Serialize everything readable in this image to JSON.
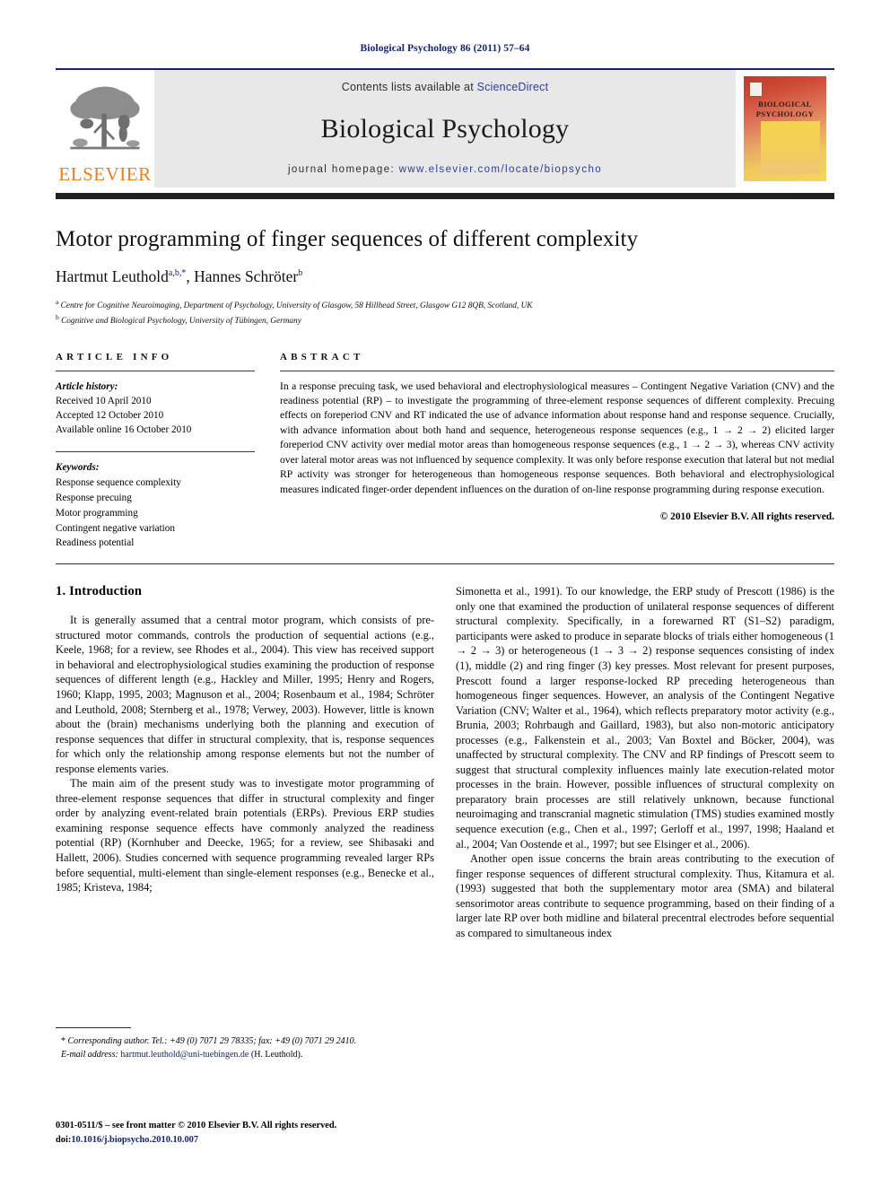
{
  "running_head": "Biological Psychology 86 (2011) 57–64",
  "masthead": {
    "contents_prefix": "Contents lists available at ",
    "sciencedirect": "ScienceDirect",
    "journal_title": "Biological Psychology",
    "homepage_prefix": "journal homepage: ",
    "homepage_url": "www.elsevier.com/locate/biopsycho",
    "publisher_logo_text": "ELSEVIER",
    "cover_title": "BIOLOGICAL PSYCHOLOGY",
    "accent_blue": "#2b3f97",
    "accent_orange": "#ef7d1a",
    "rule_dark": "#231f20"
  },
  "article": {
    "title": "Motor programming of finger sequences of different complexity",
    "authors_html": "Hartmut Leuthold<sup>a,b,*</sup>, Hannes Schröter<sup>b</sup>",
    "affiliation_a": "Centre for Cognitive Neuroimaging, Department of Psychology, University of Glasgow, 58 Hillhead Street, Glasgow G12 8QB, Scotland, UK",
    "affiliation_b": "Cognitive and Biological Psychology, University of Tübingen, Germany"
  },
  "article_info": {
    "heading": "ARTICLE INFO",
    "history_label": "Article history:",
    "received": "Received 10 April 2010",
    "accepted": "Accepted 12 October 2010",
    "available": "Available online 16 October 2010",
    "keywords_label": "Keywords:",
    "keywords": [
      "Response sequence complexity",
      "Response precuing",
      "Motor programming",
      "Contingent negative variation",
      "Readiness potential"
    ]
  },
  "abstract": {
    "heading": "ABSTRACT",
    "text": "In a response precuing task, we used behavioral and electrophysiological measures – Contingent Negative Variation (CNV) and the readiness potential (RP) – to investigate the programming of three-element response sequences of different complexity. Precuing effects on foreperiod CNV and RT indicated the use of advance information about response hand and response sequence. Crucially, with advance information about both hand and sequence, heterogeneous response sequences (e.g., 1 → 2 → 2) elicited larger foreperiod CNV activity over medial motor areas than homogeneous response sequences (e.g., 1 → 2 → 3), whereas CNV activity over lateral motor areas was not influenced by sequence complexity. It was only before response execution that lateral but not medial RP activity was stronger for heterogeneous than homogeneous response sequences. Both behavioral and electrophysiological measures indicated finger-order dependent influences on the duration of on-line response programming during response execution.",
    "copyright": "© 2010 Elsevier B.V. All rights reserved."
  },
  "introduction": {
    "heading": "1. Introduction",
    "p1": "It is generally assumed that a central motor program, which consists of pre-structured motor commands, controls the production of sequential actions (e.g., Keele, 1968; for a review, see Rhodes et al., 2004). This view has received support in behavioral and electrophysiological studies examining the production of response sequences of different length (e.g., Hackley and Miller, 1995; Henry and Rogers, 1960; Klapp, 1995, 2003; Magnuson et al., 2004; Rosenbaum et al., 1984; Schröter and Leuthold, 2008; Sternberg et al., 1978; Verwey, 2003). However, little is known about the (brain) mechanisms underlying both the planning and execution of response sequences that differ in structural complexity, that is, response sequences for which only the relationship among response elements but not the number of response elements varies.",
    "p2": "The main aim of the present study was to investigate motor programming of three-element response sequences that differ in structural complexity and finger order by analyzing event-related brain potentials (ERPs). Previous ERP studies examining response sequence effects have commonly analyzed the readiness potential (RP) (Kornhuber and Deecke, 1965; for a review, see Shibasaki and Hallett, 2006). Studies concerned with sequence programming revealed larger RPs before sequential, multi-element than single-element responses (e.g., Benecke et al., 1985; Kristeva, 1984;",
    "p3": "Simonetta et al., 1991). To our knowledge, the ERP study of Prescott (1986) is the only one that examined the production of unilateral response sequences of different structural complexity. Specifically, in a forewarned RT (S1–S2) paradigm, participants were asked to produce in separate blocks of trials either homogeneous (1 → 2 → 3) or heterogeneous (1 → 3 → 2) response sequences consisting of index (1), middle (2) and ring finger (3) key presses. Most relevant for present purposes, Prescott found a larger response-locked RP preceding heterogeneous than homogeneous finger sequences. However, an analysis of the Contingent Negative Variation (CNV; Walter et al., 1964), which reflects preparatory motor activity (e.g., Brunia, 2003; Rohrbaugh and Gaillard, 1983), but also non-motoric anticipatory processes (e.g., Falkenstein et al., 2003; Van Boxtel and Böcker, 2004), was unaffected by structural complexity. The CNV and RP findings of Prescott seem to suggest that structural complexity influences mainly late execution-related motor processes in the brain. However, possible influences of structural complexity on preparatory brain processes are still relatively unknown, because functional neuroimaging and transcranial magnetic stimulation (TMS) studies examined mostly sequence execution (e.g., Chen et al., 1997; Gerloff et al., 1997, 1998; Haaland et al., 2004; Van Oostende et al., 1997; but see Elsinger et al., 2006).",
    "p4": "Another open issue concerns the brain areas contributing to the execution of finger response sequences of different structural complexity. Thus, Kitamura et al. (1993) suggested that both the supplementary motor area (SMA) and bilateral sensorimotor areas contribute to sequence programming, based on their finding of a larger late RP over both midline and bilateral precentral electrodes before sequential as compared to simultaneous index"
  },
  "footnote": {
    "corresponding": "Corresponding author. Tel.: +49 (0) 7071 29 78335; fax: +49 (0) 7071 29 2410.",
    "email_label": "E-mail address:",
    "email": "hartmut.leuthold@uni-tuebingen.de",
    "email_owner": "(H. Leuthold)."
  },
  "imprint": {
    "line1": "0301-0511/$ – see front matter © 2010 Elsevier B.V. All rights reserved.",
    "doi_label": "doi:",
    "doi": "10.1016/j.biopsycho.2010.10.007"
  }
}
